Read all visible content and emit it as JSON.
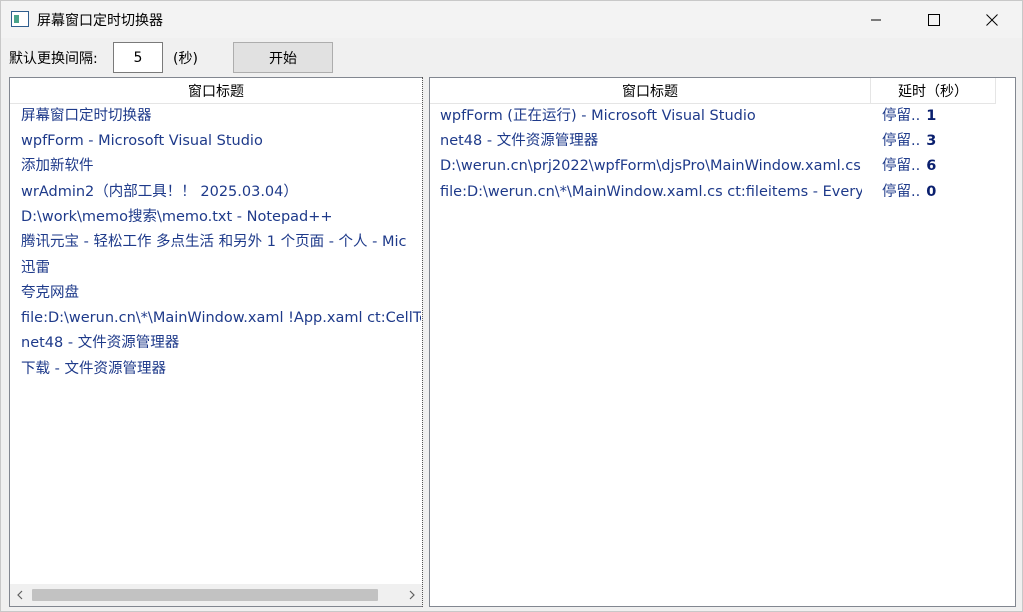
{
  "window": {
    "title": "屏幕窗口定时切换器"
  },
  "toolbar": {
    "interval_label": "默认更换间隔:",
    "interval_value": "5",
    "unit_label": "(秒)",
    "start_label": "开始"
  },
  "left_panel": {
    "header": "窗口标题",
    "items": [
      "屏幕窗口定时切换器",
      "wpfForm - Microsoft Visual Studio",
      "添加新软件",
      "wrAdmin2（内部工具！！ 2025.03.04）",
      "D:\\work\\memo搜索\\memo.txt - Notepad++",
      "腾讯元宝 - 轻松工作 多点生活 和另外 1 个页面 - 个人 - Mic",
      "迅雷",
      "夸克网盘",
      "file:D:\\werun.cn\\*\\MainWindow.xaml !App.xaml ct:CellTe",
      "net48 - 文件资源管理器",
      "下载 - 文件资源管理器"
    ]
  },
  "right_panel": {
    "header_title": "窗口标题",
    "header_delay": "延时（秒）",
    "rows": [
      {
        "title": "wpfForm (正在运行) - Microsoft Visual Studio",
        "prefix": "停留..",
        "delay": "1"
      },
      {
        "title": "net48 - 文件资源管理器",
        "prefix": "停留..",
        "delay": "3"
      },
      {
        "title": "D:\\werun.cn\\prj2022\\wpfForm\\djsPro\\MainWindow.xaml.cs",
        "prefix": "停留..",
        "delay": "6"
      },
      {
        "title": "file:D:\\werun.cn\\*\\MainWindow.xaml.cs ct:fileitems - Everyt",
        "prefix": "停留..",
        "delay": "0"
      }
    ]
  },
  "colors": {
    "item_text": "#1e3a8a",
    "delay_value": "#0a1f6e"
  }
}
